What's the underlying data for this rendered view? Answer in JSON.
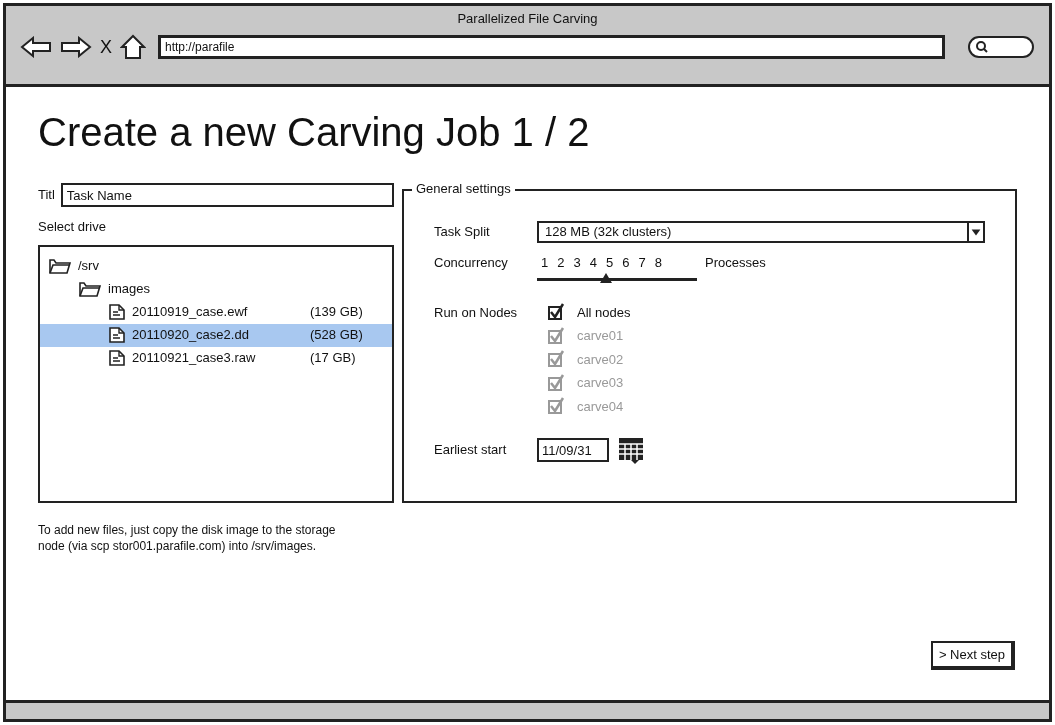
{
  "window": {
    "title": "Parallelized File Carving"
  },
  "toolbar": {
    "address": "http://parafile",
    "close_glyph": "X"
  },
  "heading": "Create a new Carving Job 1 / 2",
  "title_field": {
    "label": "Titl",
    "value": "Task Name"
  },
  "drive": {
    "label": "Select drive",
    "tree": [
      {
        "kind": "folder",
        "name": "/srv",
        "children": [
          {
            "kind": "folder",
            "name": "images",
            "children": [
              {
                "kind": "file",
                "name": "20110919_case.ewf",
                "size": "(139 GB)",
                "selected": false
              },
              {
                "kind": "file",
                "name": "20110920_case2.dd",
                "size": "(528 GB)",
                "selected": true
              },
              {
                "kind": "file",
                "name": "20110921_case3.raw",
                "size": "(17 GB)",
                "selected": false
              }
            ]
          }
        ]
      }
    ]
  },
  "help_text": "To add new files, just copy the disk image to the storage node (via scp stor001.parafile.com) into /srv/images.",
  "settings": {
    "title": "General settings",
    "task_split": {
      "label": "Task Split",
      "value": "128 MB (32k clusters)"
    },
    "concurrency": {
      "label": "Concurrency",
      "ticks": [
        "1",
        "2",
        "3",
        "4",
        "5",
        "6",
        "7",
        "8"
      ],
      "unit": "Processes",
      "level": 0.43
    },
    "nodes": {
      "label": "Run on Nodes",
      "items": [
        {
          "label": "All nodes",
          "checked": true,
          "disabled": false
        },
        {
          "label": "carve01",
          "checked": true,
          "disabled": true
        },
        {
          "label": "carve02",
          "checked": true,
          "disabled": true
        },
        {
          "label": "carve03",
          "checked": true,
          "disabled": true
        },
        {
          "label": "carve04",
          "checked": true,
          "disabled": true
        }
      ]
    },
    "earliest_start": {
      "label": "Earliest start",
      "value": "11/09/31"
    }
  },
  "next_button": "> Next step"
}
